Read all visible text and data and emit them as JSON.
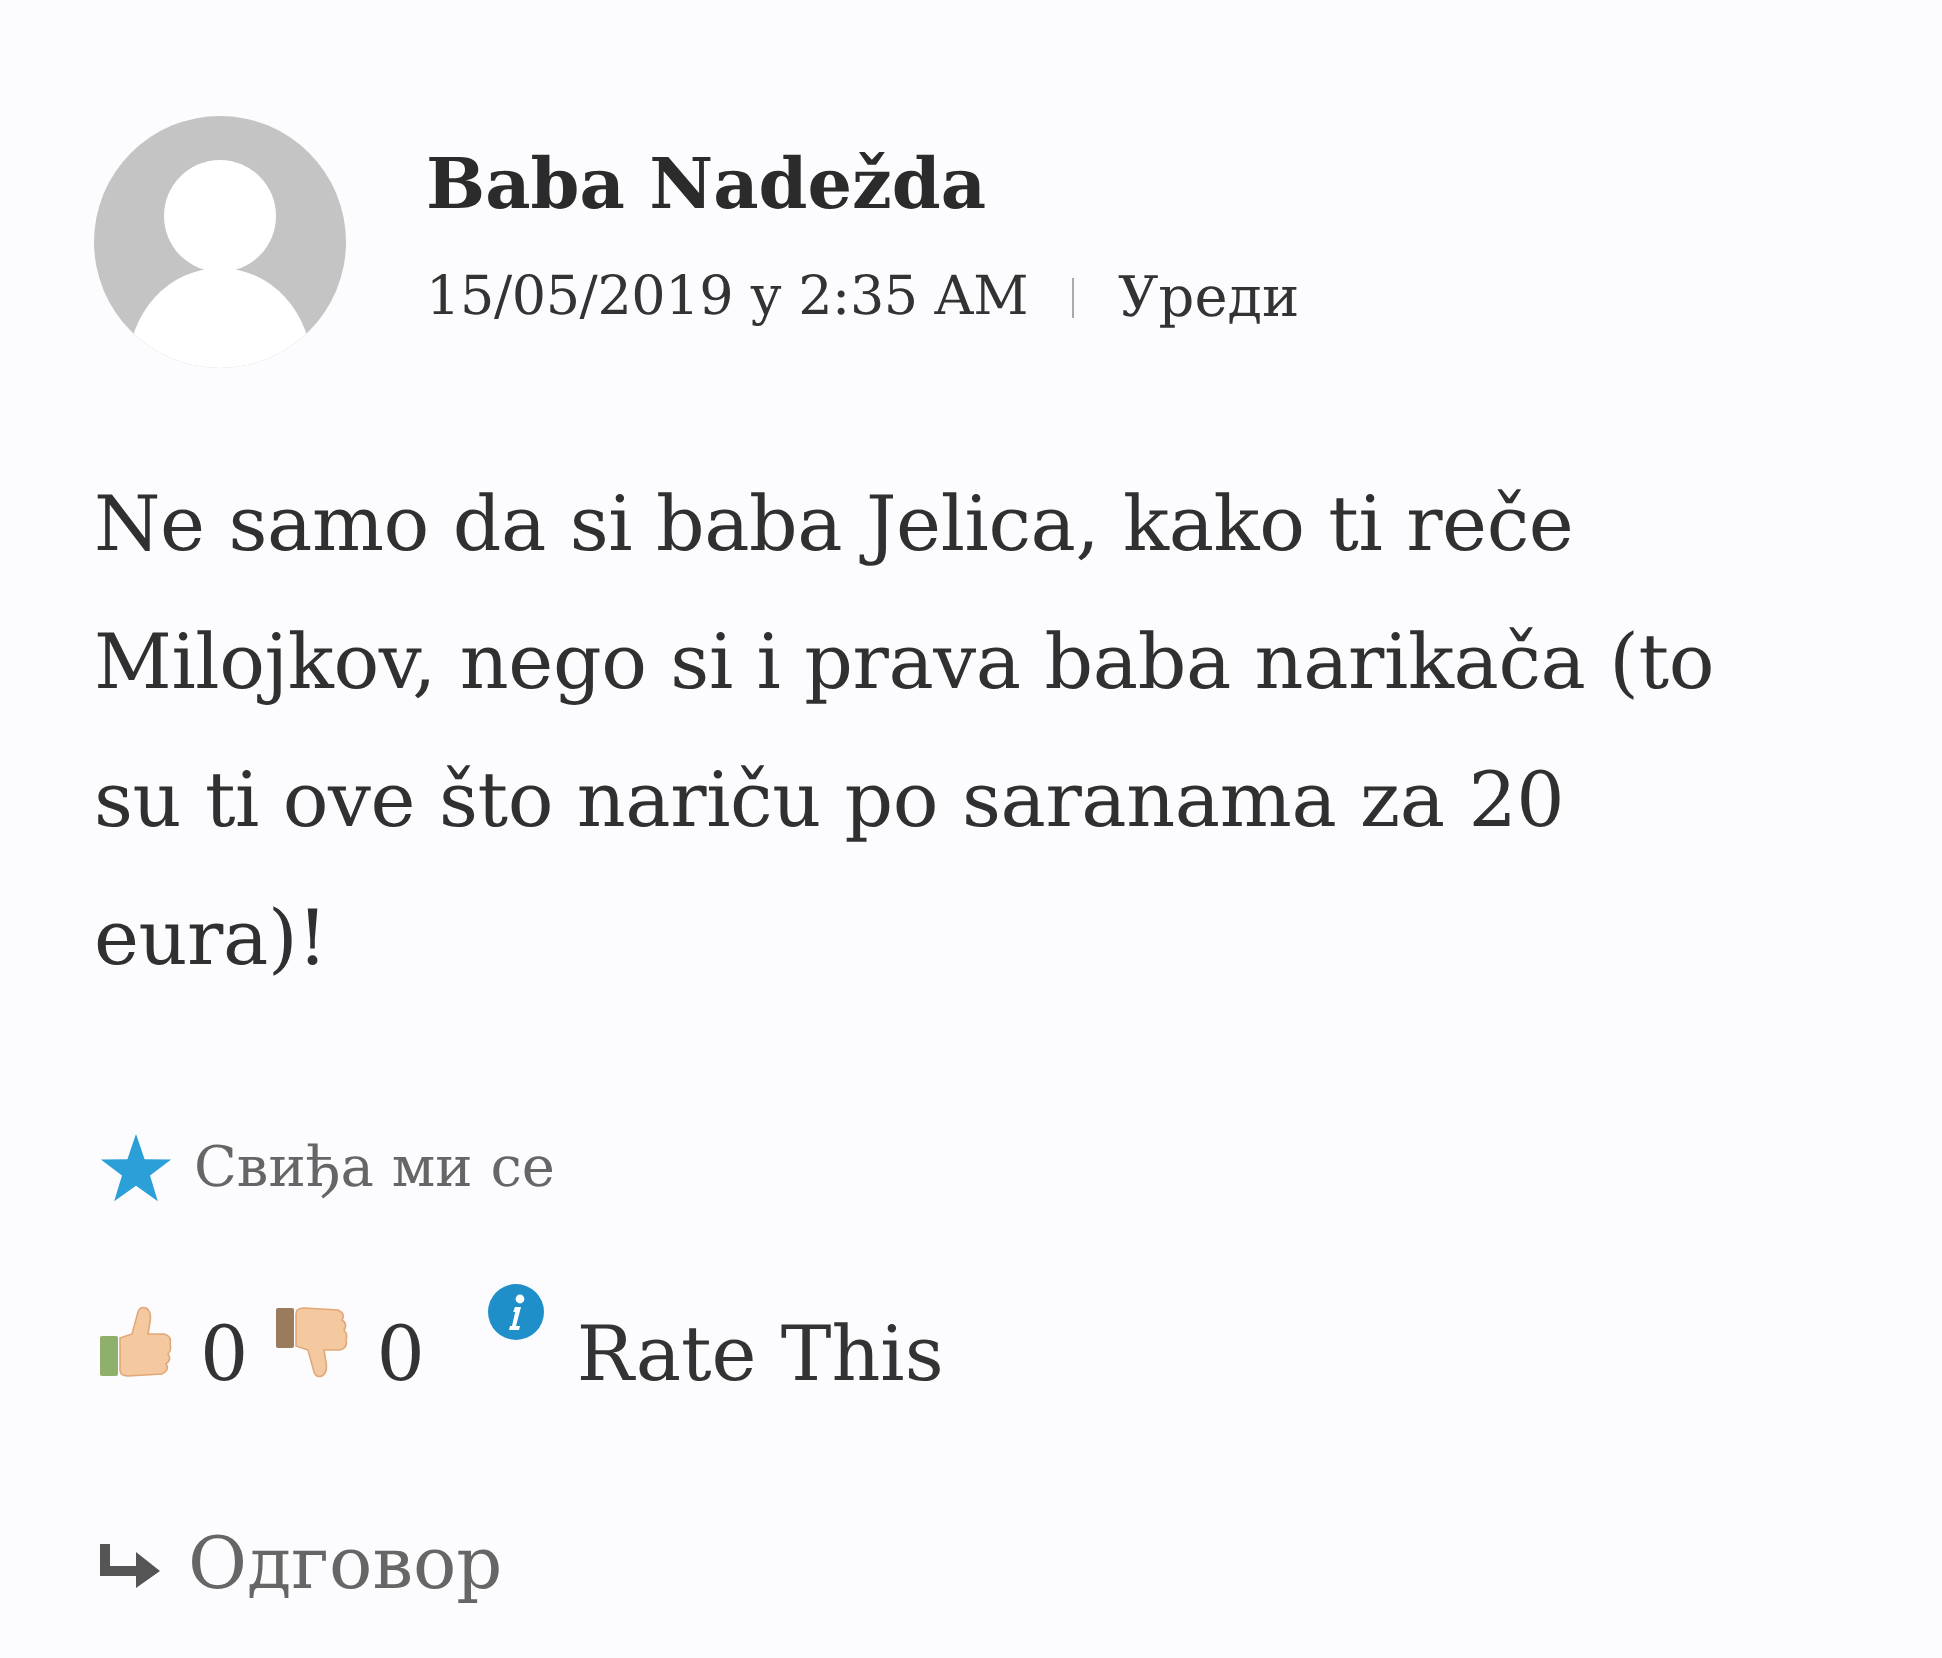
{
  "comment": {
    "author": "Baba Nadežda",
    "date": "15/05/2019 у 2:35 AM",
    "edit_link": "Уреди",
    "text": "Ne samo da si baba Jelica, kako ti reče Milojkov, nego si i prava baba narikača (to su ti ove što nariču po saranama za 20 eura)!"
  },
  "like": {
    "label": "Свиђа ми се"
  },
  "rating": {
    "up_count": "0",
    "down_count": "0",
    "label": "Rate This"
  },
  "reply": {
    "label": "Одговор"
  }
}
